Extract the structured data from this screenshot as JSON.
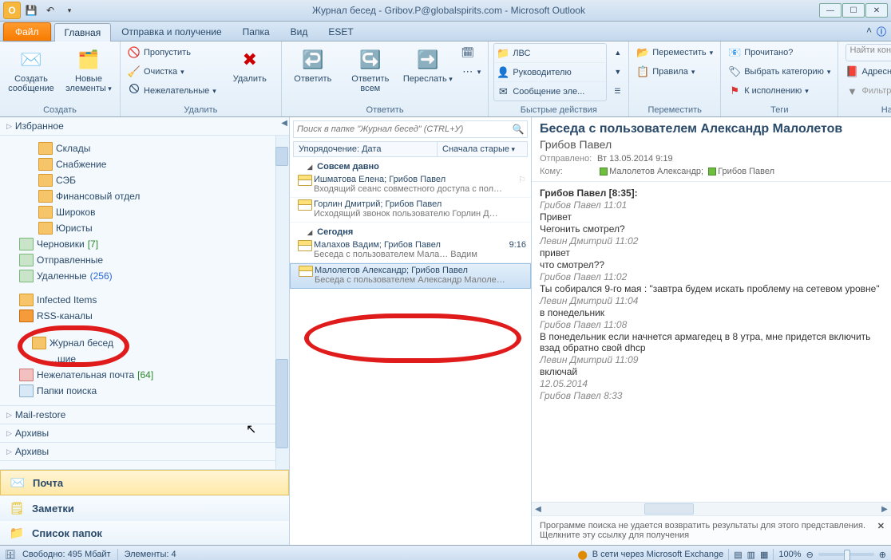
{
  "titlebar": {
    "title": "Журнал бесед - Gribov.P@globalspirits.com - Microsoft Outlook"
  },
  "tabs": {
    "file": "Файл",
    "items": [
      "Главная",
      "Отправка и получение",
      "Папка",
      "Вид",
      "ESET"
    ],
    "activeIndex": 0
  },
  "ribbon": {
    "create": {
      "big1": "Создать\nсообщение",
      "big2": "Новые\nэлементы",
      "label": "Создать"
    },
    "delete": {
      "skip": "Пропустить",
      "clean": "Очистка",
      "junk": "Нежелательные",
      "big": "Удалить",
      "label": "Удалить"
    },
    "respond": {
      "reply": "Ответить",
      "replyall": "Ответить\nвсем",
      "forward": "Переслать",
      "label": "Ответить"
    },
    "quick": {
      "a": "ЛВС",
      "b": "Руководителю",
      "c": "Сообщение эле...",
      "label": "Быстрые действия"
    },
    "move": {
      "move": "Переместить",
      "rules": "Правила",
      "label": "Переместить"
    },
    "tags": {
      "read": "Прочитано?",
      "cat": "Выбрать категорию",
      "follow": "К исполнению",
      "label": "Теги"
    },
    "find": {
      "ph": "Найти контакт",
      "addr": "Адресная книга",
      "filter": "Фильтр почты",
      "label": "Найти"
    }
  },
  "nav": {
    "favorites": "Избранное",
    "folders": [
      {
        "name": "Склады"
      },
      {
        "name": "Снабжение"
      },
      {
        "name": "СЭБ"
      },
      {
        "name": "Финансовый отдел"
      },
      {
        "name": "Широков"
      },
      {
        "name": "Юристы"
      }
    ],
    "drafts": {
      "name": "Черновики",
      "count": "[7]"
    },
    "sent": "Отправленные",
    "deleted": {
      "name": "Удаленные",
      "count": "(256)"
    },
    "infected": "Infected Items",
    "rss": "RSS-каналы",
    "chatlog": "Журнал бесед",
    "dotted": "…шие",
    "junk": {
      "name": "Нежелательная почта",
      "count": "[64]"
    },
    "search": "Папки поиска",
    "mailrestore": "Mail-restore",
    "arch1": "Архивы",
    "arch2": "Архивы",
    "btn_mail": "Почта",
    "btn_notes": "Заметки",
    "btn_folders": "Список папок"
  },
  "mlist": {
    "search_ph": "Поиск в папке \"Журнал бесед\" (CTRL+У)",
    "sort_by": "Упорядочение: Дата",
    "sort_dir": "Сначала старые",
    "g1": "Совсем давно",
    "m1_from": "Ишматова Елена; Грибов Павел",
    "m1_subj": "Входящий сеанс совместного доступа с пол…",
    "m2_from": "Горлин Дмитрий; Грибов Павел",
    "m2_subj": "Исходящий звонок пользователю Горлин Д…",
    "g2": "Сегодня",
    "m3_from": "Малахов Вадим; Грибов Павел",
    "m3_subj": "Беседа с пользователем Мала…  Вадим",
    "m3_time": "9:16",
    "m4_from": "Малолетов Александр; Грибов Павел",
    "m4_subj": "Беседа с пользователем Александр Малоле…"
  },
  "reading": {
    "subject": "Беседа с пользователем Александр Малолетов",
    "from": "Грибов Павел",
    "sent_lbl": "Отправлено:",
    "sent": "Вт 13.05.2014 9:19",
    "to_lbl": "Кому:",
    "to1": "Малолетов Александр;",
    "to2": "Грибов Павел",
    "lines": [
      {
        "t": "Грибов Павел  [8:35]:",
        "b": true
      },
      {
        "t": "Грибов Павел 11:01",
        "i": true
      },
      {
        "t": "Привет"
      },
      {
        "t": "Чегонить смотрел?"
      },
      {
        "t": "Левин Дмитрий 11:02",
        "i": true
      },
      {
        "t": "привет"
      },
      {
        "t": "что смотрел??"
      },
      {
        "t": "Грибов Павел 11:02",
        "i": true
      },
      {
        "t": "Ты собирался 9-го мая : \"завтра будем искать проблему на сетевом уровне\""
      },
      {
        "t": "Левин Дмитрий 11:04",
        "i": true
      },
      {
        "t": "в понедельник"
      },
      {
        "t": "Грибов Павел 11:08",
        "i": true
      },
      {
        "t": "В понедельник если начнется армагедец в 8 утра, мне придется включить взад обратно свой dhcp"
      },
      {
        "t": "Левин Дмитрий 11:09",
        "i": true
      },
      {
        "t": "включай"
      },
      {
        "t": "12.05.2014",
        "i": true
      },
      {
        "t": "Грибов Павел 8:33",
        "i": true
      }
    ],
    "footer": "Программе поиска не удается возвратить результаты для этого представления. Щелкните эту ссылку для получения"
  },
  "status": {
    "free": "Свободно: 495 Мбайт",
    "items": "Элементы: 4",
    "online": "В сети через Microsoft Exchange",
    "zoom": "100%"
  }
}
